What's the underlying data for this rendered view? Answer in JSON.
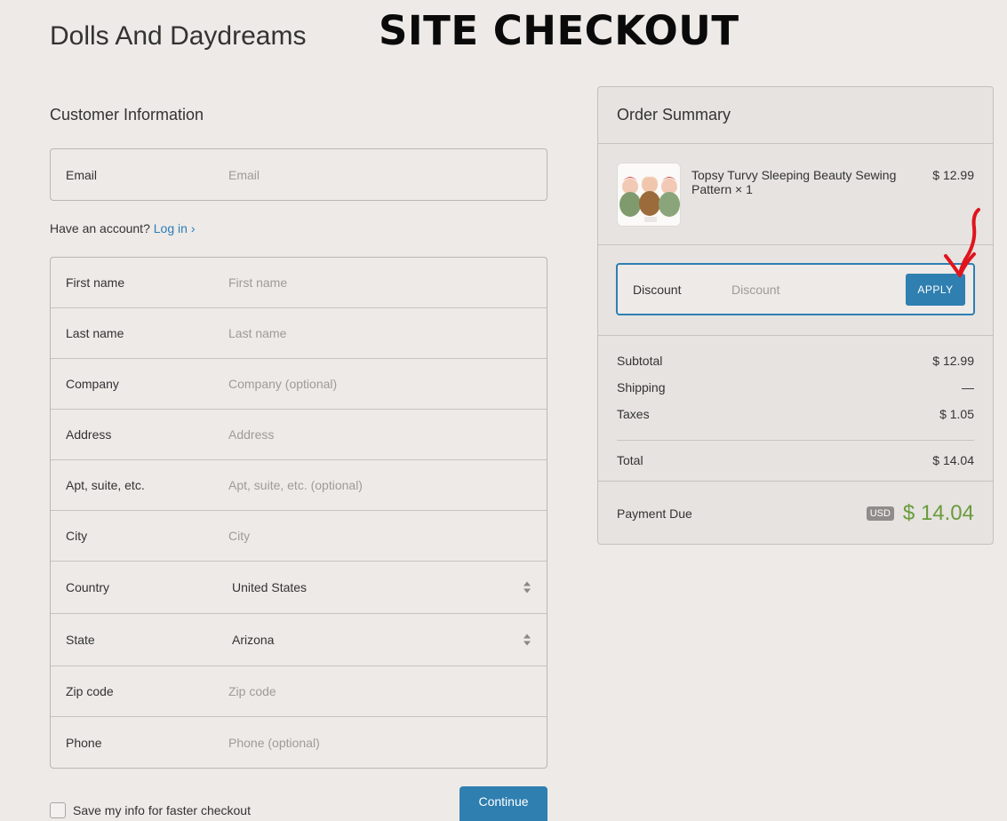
{
  "store_name": "Dolls And Daydreams",
  "banner": "SITE CHECKOUT",
  "customer": {
    "title": "Customer Information",
    "email": {
      "label": "Email",
      "placeholder": "Email"
    },
    "account_prompt": "Have an account?",
    "login_link": "Log in",
    "fields": {
      "first_name": {
        "label": "First name",
        "placeholder": "First name"
      },
      "last_name": {
        "label": "Last name",
        "placeholder": "Last name"
      },
      "company": {
        "label": "Company",
        "placeholder": "Company (optional)"
      },
      "address": {
        "label": "Address",
        "placeholder": "Address"
      },
      "apt": {
        "label": "Apt, suite, etc.",
        "placeholder": "Apt, suite, etc. (optional)"
      },
      "city": {
        "label": "City",
        "placeholder": "City"
      },
      "country": {
        "label": "Country",
        "value": "United States"
      },
      "state": {
        "label": "State",
        "value": "Arizona"
      },
      "zip": {
        "label": "Zip code",
        "placeholder": "Zip code"
      },
      "phone": {
        "label": "Phone",
        "placeholder": "Phone (optional)"
      }
    },
    "save_info": "Save my info for faster checkout",
    "continue": "Continue"
  },
  "summary": {
    "title": "Order Summary",
    "product": {
      "name": "Topsy Turvy Sleeping Beauty Sewing Pattern × 1",
      "price": "$ 12.99"
    },
    "discount": {
      "label": "Discount",
      "placeholder": "Discount",
      "apply": "APPLY"
    },
    "subtotal": {
      "label": "Subtotal",
      "value": "$ 12.99"
    },
    "shipping": {
      "label": "Shipping",
      "value": "—"
    },
    "taxes": {
      "label": "Taxes",
      "value": "$ 1.05"
    },
    "total": {
      "label": "Total",
      "value": "$ 14.04"
    },
    "payment_due": {
      "label": "Payment Due",
      "currency": "USD",
      "value": "$ 14.04"
    }
  },
  "colors": {
    "accent": "#2f7fb0",
    "price_green": "#6a9b3d",
    "annotation_arrow": "#e0141e"
  }
}
